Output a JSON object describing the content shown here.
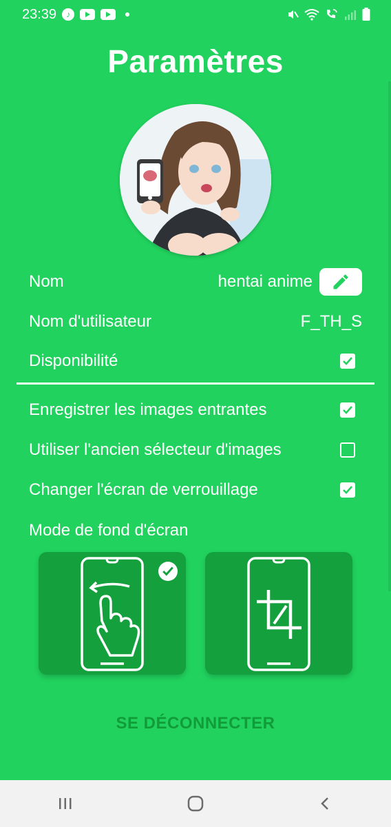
{
  "status_bar": {
    "time": "23:39",
    "icons_left": [
      "music-icon",
      "youtube-icon",
      "youtube-icon",
      "dot-icon"
    ],
    "icons_right": [
      "mute-icon",
      "wifi-icon",
      "wifi-call-icon",
      "signal-icon",
      "battery-icon"
    ]
  },
  "page": {
    "title": "Paramètres"
  },
  "profile": {
    "avatar": "profile-avatar",
    "name_label": "Nom",
    "name_value": "hentai anime",
    "username_label": "Nom d'utilisateur",
    "username_value": "F_TH_S",
    "availability_label": "Disponibilité",
    "availability_checked": true
  },
  "settings": {
    "items": [
      {
        "label": "Enregistrer les images entrantes",
        "checked": true
      },
      {
        "label": "Utiliser l'ancien sélecteur d'images",
        "checked": false
      },
      {
        "label": "Changer l'écran de verrouillage",
        "checked": true
      }
    ],
    "wallpaper_mode_label": "Mode de fond d'écran",
    "wallpaper_modes": [
      {
        "icon": "swipe-hand-icon",
        "selected": true
      },
      {
        "icon": "crop-icon",
        "selected": false
      }
    ]
  },
  "logout_label": "SE DÉCONNECTER",
  "colors": {
    "background": "#21d35e",
    "card": "#13a03d",
    "logout_text": "#129c39"
  },
  "nav_bar": {
    "buttons": [
      "recents-icon",
      "home-icon",
      "back-icon"
    ]
  }
}
